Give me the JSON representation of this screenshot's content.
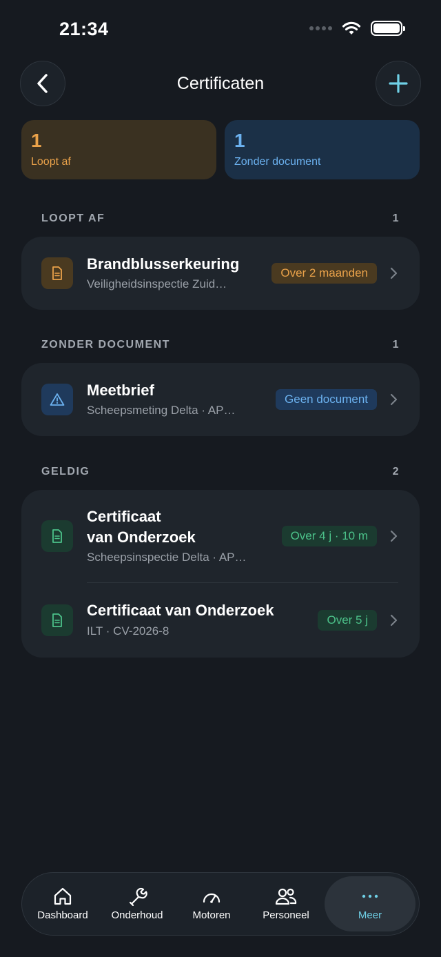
{
  "status": {
    "time": "21:34"
  },
  "header": {
    "title": "Certificaten"
  },
  "summary": [
    {
      "count": "1",
      "label": "Loopt af",
      "color": "#eaa24a"
    },
    {
      "count": "1",
      "label": "Zonder document",
      "color": "#6cb2f0"
    }
  ],
  "sections": {
    "expiring": {
      "title": "LOOPT AF",
      "count": "1",
      "items": [
        {
          "title": "Brandblusserkeuring",
          "subtitle": "Veiligheidsinspectie Zuid…",
          "badge": "Over 2 maanden",
          "icon": "document-icon"
        }
      ]
    },
    "no_document": {
      "title": "ZONDER DOCUMENT",
      "count": "1",
      "items": [
        {
          "title": "Meetbrief",
          "subtitle": "Scheepsmeting Delta · AP…",
          "badge": "Geen document",
          "icon": "warning-icon"
        }
      ]
    },
    "valid": {
      "title": "GELDIG",
      "count": "2",
      "items": [
        {
          "title_line1": "Certificaat",
          "title_line2": "van Onderzoek",
          "subtitle": "Scheepsinspectie Delta · AP…",
          "badge": "Over 4 j · 10 m",
          "icon": "document-icon"
        },
        {
          "title": "Certificaat van Onderzoek",
          "subtitle": "ILT · CV-2026-8",
          "badge": "Over 5 j",
          "icon": "document-icon"
        }
      ]
    }
  },
  "tabbar": {
    "tabs": [
      {
        "label": "Dashboard",
        "icon": "home-icon"
      },
      {
        "label": "Onderhoud",
        "icon": "wrench-icon"
      },
      {
        "label": "Motoren",
        "icon": "gauge-icon"
      },
      {
        "label": "Personeel",
        "icon": "people-icon"
      },
      {
        "label": "Meer",
        "icon": "more-icon",
        "active": true
      }
    ]
  },
  "colors": {
    "accent": "#6fd0e6",
    "background": "#161a20",
    "card": "#1f252c",
    "warning": "#eaa24a",
    "info": "#6cb2f0",
    "success": "#4cc28a"
  }
}
